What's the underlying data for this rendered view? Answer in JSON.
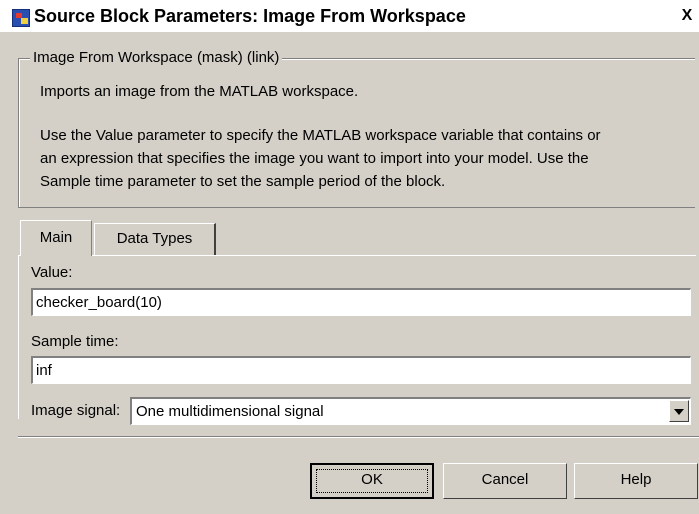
{
  "window": {
    "title": "Source Block Parameters: Image From Workspace",
    "close_label": "X"
  },
  "block": {
    "group_title": "Image From Workspace (mask) (link)",
    "description_lines": [
      "Imports an image from the MATLAB workspace.",
      "Use the Value parameter to specify the MATLAB workspace variable that contains or",
      "an expression that specifies the image you want to import into your model. Use the",
      "Sample time parameter to set the sample period of the block."
    ]
  },
  "tabs": [
    {
      "label": "Main",
      "selected": true
    },
    {
      "label": "Data Types",
      "selected": false
    }
  ],
  "params": {
    "value_label": "Value:",
    "value": "checker_board(10)",
    "sample_time_label": "Sample time:",
    "sample_time": "inf",
    "image_signal_label": "Image signal:",
    "image_signal": "One multidimensional signal"
  },
  "buttons": {
    "ok": "OK",
    "cancel": "Cancel",
    "help": "Help"
  },
  "icons": {
    "app": "simulink-block-icon",
    "close": "close-icon",
    "dropdown": "chevron-down-icon"
  }
}
